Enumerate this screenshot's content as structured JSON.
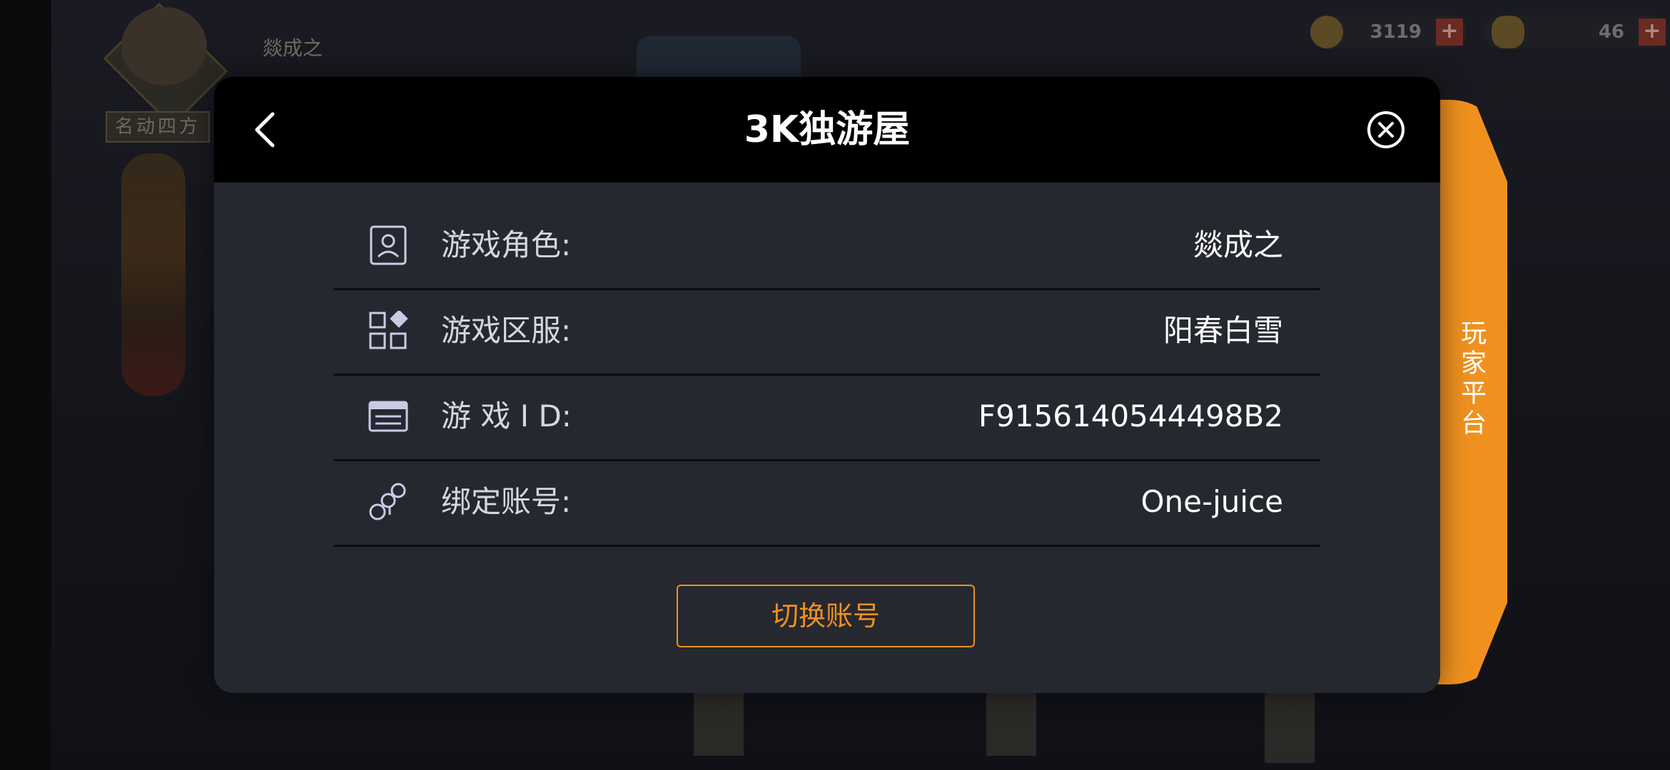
{
  "game_background": {
    "player_name": "燚成之",
    "rank_label": "名动四方",
    "currency_1_amount": "3119",
    "currency_2_amount": "46",
    "plus_symbol": "+"
  },
  "dialog": {
    "title": "3K独游屋",
    "rows": [
      {
        "icon": "user-profile-icon",
        "label": "游戏角色:",
        "value": "燚成之"
      },
      {
        "icon": "server-grid-icon",
        "label": "游戏区服:",
        "value": "阳春白雪"
      },
      {
        "icon": "id-card-icon",
        "label": "游 戏 I D:",
        "value": "F9156140544498B2"
      },
      {
        "icon": "linked-account-icon",
        "label": "绑定账号:",
        "value": "One-juice"
      }
    ],
    "switch_account_label": "切换账号"
  },
  "side_tab": {
    "label": "玩家平台"
  },
  "colors": {
    "accent": "#f0911f",
    "dialog_bg": "#262830",
    "header_bg": "#000000"
  }
}
